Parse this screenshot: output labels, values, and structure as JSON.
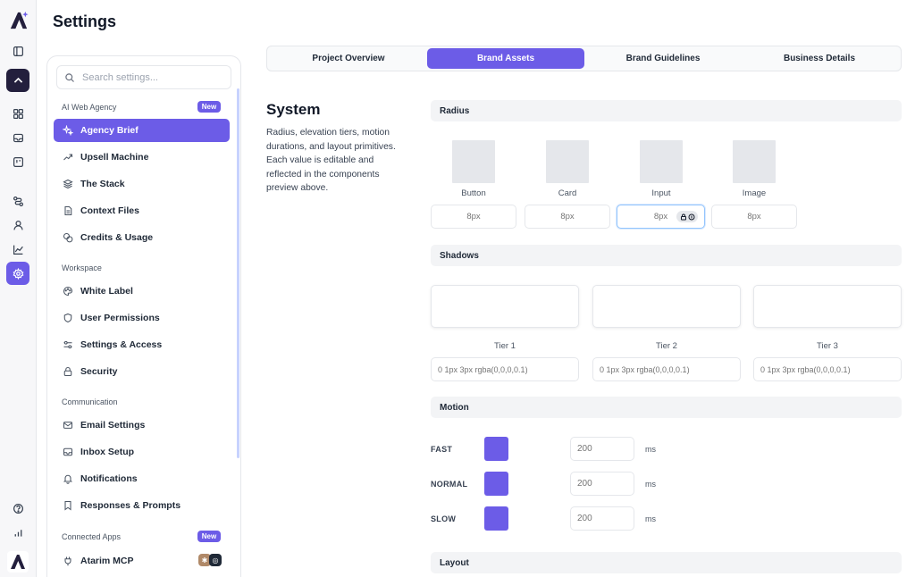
{
  "header": {
    "title": "Settings"
  },
  "rail": {
    "icons": [
      "brand-logo",
      "sidebar-toggle-icon",
      "chevron-up-icon",
      "grid-icon",
      "inbox-icon",
      "board-icon",
      "route-icon",
      "user-icon",
      "chart-icon",
      "gear-icon",
      "help-icon",
      "bar-chart-icon",
      "brand-logo"
    ]
  },
  "sidebar": {
    "search_placeholder": "Search settings...",
    "new_badge": "New",
    "sections": [
      {
        "label": "AI Web Agency",
        "badge": "New"
      },
      {
        "label": "Workspace"
      },
      {
        "label": "Communication"
      },
      {
        "label": "Connected Apps",
        "badge": "New"
      }
    ],
    "items": [
      {
        "label": "Agency Brief",
        "icon": "sparkle-icon",
        "active": true
      },
      {
        "label": "Upsell Machine",
        "icon": "trend-up-icon"
      },
      {
        "label": "The Stack",
        "icon": "layers-icon"
      },
      {
        "label": "Context Files",
        "icon": "file-icon"
      },
      {
        "label": "Credits & Usage",
        "icon": "coins-icon"
      },
      {
        "label": "White Label",
        "icon": "palette-icon"
      },
      {
        "label": "User Permissions",
        "icon": "shield-icon"
      },
      {
        "label": "Settings & Access",
        "icon": "sliders-icon"
      },
      {
        "label": "Security",
        "icon": "lock-icon"
      },
      {
        "label": "Email Settings",
        "icon": "mail-icon"
      },
      {
        "label": "Inbox Setup",
        "icon": "inbox-icon"
      },
      {
        "label": "Notifications",
        "icon": "bell-icon"
      },
      {
        "label": "Responses & Prompts",
        "icon": "bookmark-icon"
      },
      {
        "label": "Atarim MCP",
        "icon": "plug-icon"
      }
    ]
  },
  "tabs": [
    {
      "label": "Project Overview"
    },
    {
      "label": "Brand Assets",
      "active": true
    },
    {
      "label": "Brand Guidelines"
    },
    {
      "label": "Business Details"
    }
  ],
  "system": {
    "title": "System",
    "description": "Radius, elevation tiers, motion durations, and layout primitives. Each value is editable and reflected in the components preview above."
  },
  "radius": {
    "heading": "Radius",
    "items": [
      {
        "label": "Button",
        "value": "8px"
      },
      {
        "label": "Card",
        "value": "8px"
      },
      {
        "label": "Input",
        "value": "8px"
      },
      {
        "label": "Image",
        "value": "8px"
      }
    ]
  },
  "shadows": {
    "heading": "Shadows",
    "items": [
      {
        "label": "Tier 1",
        "value": "0 1px 3px rgba(0,0,0,0.1)"
      },
      {
        "label": "Tier 2",
        "value": "0 1px 3px rgba(0,0,0,0.1)"
      },
      {
        "label": "Tier 3",
        "value": "0 1px 3px rgba(0,0,0,0.1)"
      }
    ]
  },
  "motion": {
    "heading": "Motion",
    "unit": "ms",
    "items": [
      {
        "label": "FAST",
        "value": "200"
      },
      {
        "label": "NORMAL",
        "value": "200"
      },
      {
        "label": "SLOW",
        "value": "200"
      }
    ]
  },
  "layout": {
    "heading": "Layout"
  },
  "colors": {
    "accent": "#6c5ce7",
    "dark": "#231f3d"
  }
}
